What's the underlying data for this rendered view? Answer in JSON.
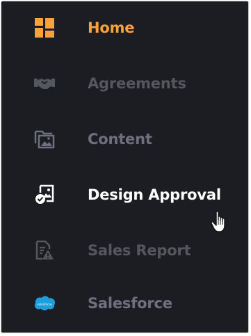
{
  "nav": {
    "items": [
      {
        "label": "Home",
        "icon": "dashboard-icon",
        "state": "active",
        "color": "#f7a23b"
      },
      {
        "label": "Agreements",
        "icon": "handshake-icon",
        "state": "dim",
        "color": "#55575f"
      },
      {
        "label": "Content",
        "icon": "media-folder-icon",
        "state": "normal",
        "color": "#6e7080"
      },
      {
        "label": "Design Approval",
        "icon": "image-approval-icon",
        "state": "hover",
        "color": "#ffffff"
      },
      {
        "label": "Sales Report",
        "icon": "report-warning-icon",
        "state": "dim",
        "color": "#55575f"
      },
      {
        "label": "Salesforce",
        "icon": "salesforce-cloud-icon",
        "state": "normal",
        "color": "#6e7080"
      }
    ],
    "salesforce_logo_text": "salesforce"
  },
  "colors": {
    "background": "#1c1d22",
    "accent": "#f7a23b",
    "salesforce_blue": "#1d9fdb"
  },
  "cursor": "hand-pointer-icon"
}
